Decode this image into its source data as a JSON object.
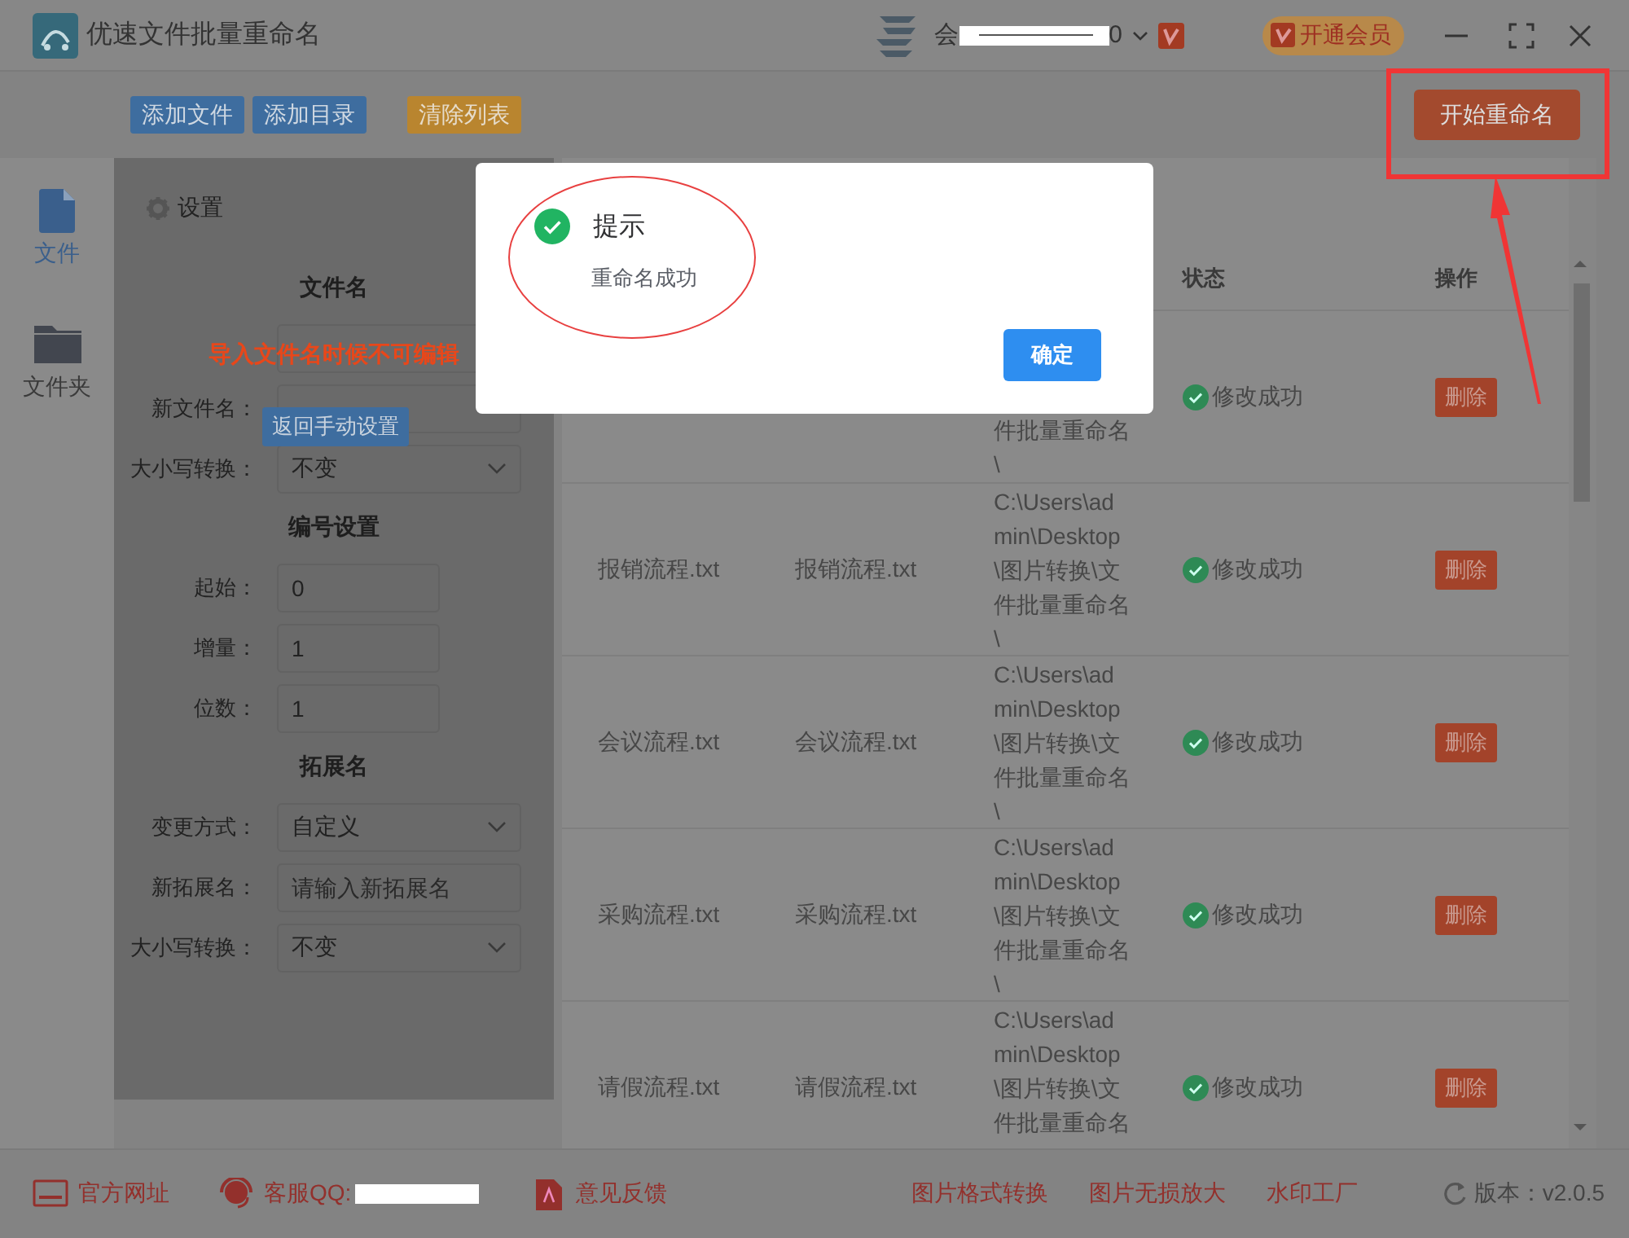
{
  "window": {
    "title": "优速文件批量重命名",
    "account_prefix": "会",
    "account_suffix": "0",
    "vip_button": "开通会员"
  },
  "toolbar": {
    "buttons": [
      {
        "label": "添加文件",
        "kind": "blue"
      },
      {
        "label": "添加目录",
        "kind": "blue"
      },
      {
        "label": "清除列表",
        "kind": "orange"
      }
    ],
    "start_button": "开始重命名"
  },
  "sidebar": {
    "items": [
      {
        "label": "文件",
        "kind": "file",
        "selected": true
      },
      {
        "label": "文件夹",
        "kind": "folder",
        "selected": false
      }
    ]
  },
  "settings": {
    "title": "设置",
    "lock_notice": "导入文件名时候不可编辑",
    "back_button": "返回手动设置",
    "sections": [
      {
        "heading": "文件名",
        "fields": [
          {
            "kind": "select"
          },
          {
            "label": "新文件名：",
            "kind": "input"
          },
          {
            "label": "大小写转换：",
            "kind": "select",
            "value": "不变"
          }
        ]
      },
      {
        "heading": "编号设置",
        "fields": [
          {
            "label": "起始：",
            "kind": "number",
            "value": "0"
          },
          {
            "label": "增量：",
            "kind": "number",
            "value": "1"
          },
          {
            "label": "位数：",
            "kind": "number",
            "value": "1"
          }
        ]
      },
      {
        "heading": "拓展名",
        "fields": [
          {
            "label": "变更方式：",
            "kind": "select",
            "value": "自定义"
          },
          {
            "label": "新拓展名：",
            "kind": "input",
            "placeholder": "请输入新拓展名"
          },
          {
            "label": "大小写转换：",
            "kind": "select",
            "value": "不变"
          }
        ]
      }
    ]
  },
  "table": {
    "columns": [
      {},
      {},
      {},
      {
        "label": "状态"
      },
      {
        "label": "操作"
      }
    ],
    "rows": [
      {
        "path": "件批量重命名\\",
        "status": "修改成功",
        "action": "删除"
      },
      {
        "original": "报销流程.txt",
        "new": "报销流程.txt",
        "path": "C:\\Users\\admin\\Desktop\\图片转换\\文件批量重命名\\",
        "status": "修改成功",
        "action": "删除"
      },
      {
        "original": "会议流程.txt",
        "new": "会议流程.txt",
        "path": "C:\\Users\\admin\\Desktop\\图片转换\\文件批量重命名\\",
        "status": "修改成功",
        "action": "删除"
      },
      {
        "original": "采购流程.txt",
        "new": "采购流程.txt",
        "path": "C:\\Users\\admin\\Desktop\\图片转换\\文件批量重命名\\",
        "status": "修改成功",
        "action": "删除"
      },
      {
        "original": "请假流程.txt",
        "new": "请假流程.txt",
        "path": "C:\\Users\\admin\\Desktop\\图片转换\\文件批量重命名",
        "status": "修改成功",
        "action": "删除"
      }
    ]
  },
  "dialog": {
    "title": "提示",
    "message": "重命名成功",
    "button": "确定"
  },
  "status_bar": {
    "items": [
      {
        "label": "官方网址",
        "kind": "web"
      },
      {
        "label": "客服QQ:",
        "kind": "qq"
      },
      {
        "label": "意见反馈",
        "kind": "feedback"
      },
      {
        "label": "图片格式转换",
        "kind": "link"
      },
      {
        "label": "图片无损放大",
        "kind": "link"
      },
      {
        "label": "水印工厂",
        "kind": "link"
      }
    ],
    "version": "版本：v2.0.5"
  },
  "annotations": [
    {
      "kind": "ellipse"
    },
    {
      "kind": "rectangle"
    },
    {
      "kind": "arrow"
    }
  ]
}
